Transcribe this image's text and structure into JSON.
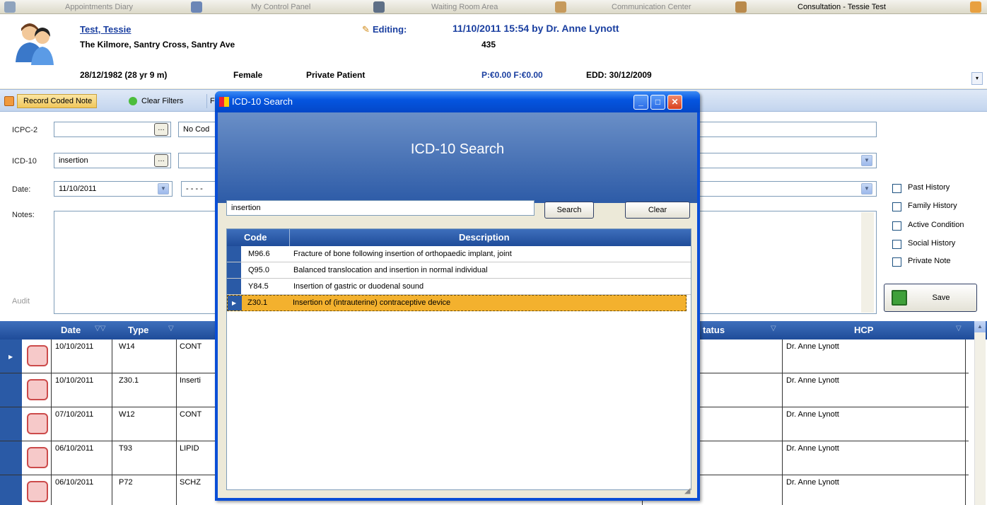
{
  "top_tabs": [
    {
      "label": "Appointments Diary",
      "active": false
    },
    {
      "label": "My Control Panel",
      "active": false
    },
    {
      "label": "Waiting Room Area",
      "active": false
    },
    {
      "label": "Communication Center",
      "active": false
    },
    {
      "label": "Consultation - Tessie Test",
      "active": true
    }
  ],
  "patient": {
    "name": "Test, Tessie",
    "address": "The Kilmore, Santry Cross, Santry Ave",
    "dob": "28/12/1982 (28 yr 9 m)",
    "sex": "Female",
    "type": "Private Patient",
    "editing_label": "Editing:",
    "editing_value": "11/10/2011 15:54 by Dr. Anne Lynott",
    "number": "435",
    "balance": "P:€0.00 F:€0.00",
    "edd": "EDD: 30/12/2009"
  },
  "toolbar": {
    "record_coded_note": "Record Coded Note",
    "clear_filters": "Clear Filters",
    "partial": "F"
  },
  "form": {
    "icpc_label": "ICPC-2",
    "icpc_value": "",
    "icpc_desc": "No Cod",
    "icd_label": "ICD-10",
    "icd_value": "insertion",
    "date_label": "Date:",
    "date_value": "11/10/2011",
    "date_time": "- - - -",
    "notes_label": "Notes:",
    "audit_label": "Audit",
    "checkboxes": [
      "Past History",
      "Family History",
      "Active Condition",
      "Social History",
      "Private Note"
    ],
    "save_label": "Save"
  },
  "grid": {
    "headers": {
      "date": "Date",
      "type": "Type",
      "status": "tatus",
      "hcp": "HCP"
    },
    "rows": [
      {
        "date": "10/10/2011",
        "type": "W14",
        "desc": "CONT",
        "hcp": "Dr. Anne Lynott"
      },
      {
        "date": "10/10/2011",
        "type": "Z30.1",
        "desc": "Inserti",
        "hcp": "Dr. Anne Lynott"
      },
      {
        "date": "07/10/2011",
        "type": "W12",
        "desc": "CONT",
        "hcp": "Dr. Anne Lynott"
      },
      {
        "date": "06/10/2011",
        "type": "T93",
        "desc": "LIPID",
        "hcp": "Dr. Anne Lynott"
      },
      {
        "date": "06/10/2011",
        "type": "P72",
        "desc": "SCHZ",
        "hcp": "Dr. Anne Lynott"
      }
    ]
  },
  "dialog": {
    "title": "ICD-10 Search",
    "banner": "ICD-10 Search",
    "search_value": "insertion",
    "search_label": "Search",
    "clear_label": "Clear",
    "headers": {
      "code": "Code",
      "description": "Description"
    },
    "rows": [
      {
        "code": "M96.6",
        "description": "Fracture of bone following insertion of orthopaedic implant, joint",
        "selected": false
      },
      {
        "code": "Q95.0",
        "description": "Balanced translocation and insertion in normal individual",
        "selected": false
      },
      {
        "code": "Y84.5",
        "description": "Insertion of gastric or duodenal sound",
        "selected": false
      },
      {
        "code": "Z30.1",
        "description": "Insertion of (intrauterine) contraceptive device",
        "selected": true
      }
    ]
  },
  "colors": {
    "accent": "#1f4c99",
    "selection": "#f3b12e",
    "link": "#1a3fa0"
  }
}
